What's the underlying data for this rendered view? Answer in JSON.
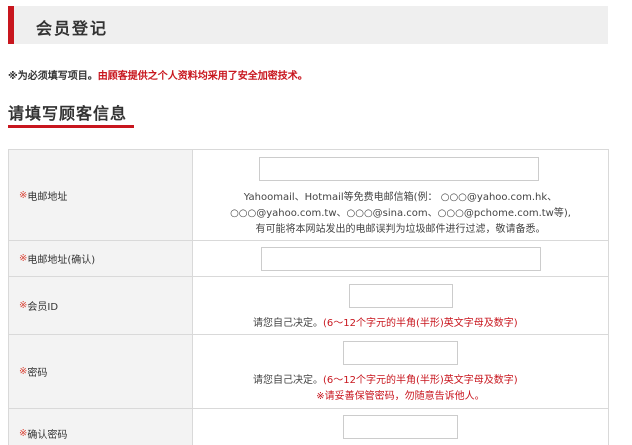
{
  "header": {
    "title": "会员登记"
  },
  "notice": {
    "required": "※为必须填写项目。",
    "security": "由顾客提供之个人资料均采用了安全加密技术。"
  },
  "section": {
    "title": "请填写顾客信息"
  },
  "form": {
    "email": {
      "mark": "※",
      "label": "电邮地址",
      "value": "",
      "note_line1": "Yahoomail、Hotmail等免费电邮信箱(例： ○○○@yahoo.com.hk、",
      "note_line2": "○○○@yahoo.com.tw、○○○@sina.com、○○○@pchome.com.tw等),",
      "note_line3": "有可能将本网站发出的电邮误判为垃圾邮件进行过滤，敬请备悉。"
    },
    "email_confirm": {
      "mark": "※",
      "label": "电邮地址(确认)",
      "value": ""
    },
    "member_id": {
      "mark": "※",
      "label": "会员ID",
      "value": "",
      "hint": "请您自己决定。",
      "rule": "(6～12个字元的半角(半形)英文字母及数字)"
    },
    "password": {
      "mark": "※",
      "label": "密码",
      "value": "",
      "hint": "请您自己决定。",
      "rule": "(6～12个字元的半角(半形)英文字母及数字)",
      "warning": "※请妥善保管密码，勿随意告诉他人。"
    },
    "password_confirm": {
      "mark": "※",
      "label": "确认密码",
      "value": ""
    }
  }
}
